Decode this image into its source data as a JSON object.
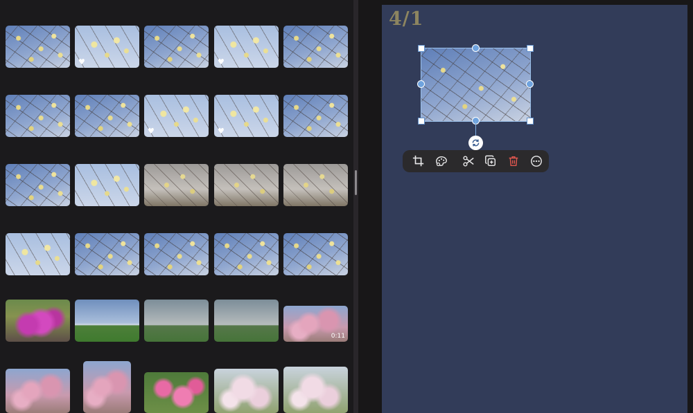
{
  "canvas": {
    "date_label": "4/1"
  },
  "grid": {
    "thumbnails": [
      {
        "style": "p-sky",
        "favorite": false
      },
      {
        "style": "p-sky2",
        "favorite": true
      },
      {
        "style": "p-sky",
        "favorite": false
      },
      {
        "style": "p-sky2",
        "favorite": true
      },
      {
        "style": "p-sky",
        "favorite": false
      },
      {
        "style": "p-sky",
        "favorite": false
      },
      {
        "style": "p-sky",
        "favorite": false
      },
      {
        "style": "p-sky2",
        "favorite": true
      },
      {
        "style": "p-sky2",
        "favorite": true
      },
      {
        "style": "p-sky",
        "favorite": false
      },
      {
        "style": "p-sky",
        "favorite": false
      },
      {
        "style": "p-sky2",
        "favorite": false
      },
      {
        "style": "p-grey",
        "favorite": false
      },
      {
        "style": "p-grey",
        "favorite": false
      },
      {
        "style": "p-grey",
        "favorite": false
      },
      {
        "style": "p-sky2",
        "favorite": false
      },
      {
        "style": "p-sky",
        "favorite": false
      },
      {
        "style": "p-sky",
        "favorite": false
      },
      {
        "style": "p-sky",
        "favorite": false
      },
      {
        "style": "p-sky",
        "favorite": false
      },
      {
        "style": "p-azalea",
        "favorite": false
      },
      {
        "style": "p-field",
        "favorite": false
      },
      {
        "style": "p-field2",
        "favorite": false
      },
      {
        "style": "p-field2",
        "favorite": false
      },
      {
        "style": "p-cherry",
        "favorite": false,
        "duration": "0:11"
      },
      {
        "style": "p-cherry",
        "favorite": false
      },
      {
        "style": "p-cherry",
        "favorite": false
      },
      {
        "style": "p-pink",
        "favorite": false
      },
      {
        "style": "p-white",
        "favorite": false
      },
      {
        "style": "p-white",
        "favorite": false
      }
    ],
    "favorite_glyph": "♥"
  },
  "toolbar": {
    "tools": [
      {
        "name": "crop-icon"
      },
      {
        "name": "palette-icon"
      },
      {
        "name": "scissors-icon"
      },
      {
        "name": "duplicate-icon"
      },
      {
        "name": "trash-icon",
        "color": "#e0574f"
      },
      {
        "name": "more-icon"
      }
    ]
  },
  "colors": {
    "page_background": "#323c59",
    "selection_accent": "#6fa3de",
    "date_text": "#8d8560"
  }
}
